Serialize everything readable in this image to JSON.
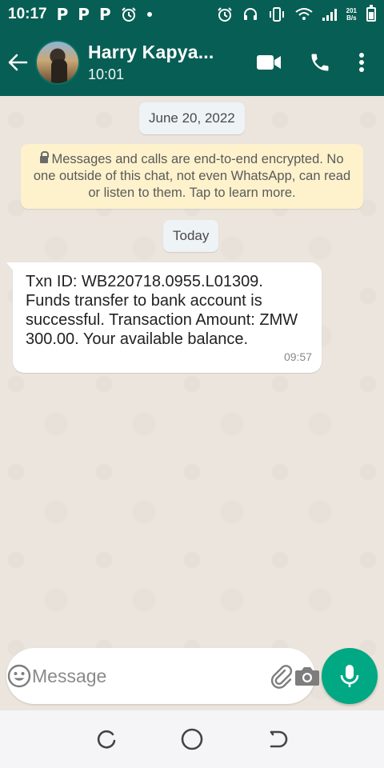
{
  "status_bar": {
    "time": "10:17",
    "left_icons": [
      "P",
      "P",
      "P"
    ],
    "speed_top": "201",
    "speed_bottom": "B/s"
  },
  "header": {
    "contact_name": "Harry Kapya...",
    "last_seen": "10:01",
    "icons": [
      "back-arrow-icon",
      "video-call-icon",
      "phone-icon",
      "more-vert-icon"
    ]
  },
  "chat": {
    "date_chip_1": "June 20, 2022",
    "encryption_notice": "Messages and calls are end-to-end encrypted. No one outside of this chat, not even WhatsApp, can read or listen to them. Tap to learn more.",
    "date_chip_2": "Today",
    "messages": [
      {
        "text": "Txn ID: WB220718.0955.L01309. Funds transfer to bank account is successful. Transaction Amount: ZMW 300.00. Your available balance.",
        "time": "09:57",
        "direction": "incoming"
      }
    ]
  },
  "composer": {
    "placeholder": "Message",
    "value": ""
  },
  "colors": {
    "header": "#075e54",
    "accent": "#00a884",
    "notice_bg": "#fdf2cc",
    "chat_bg": "#ece5dd"
  }
}
